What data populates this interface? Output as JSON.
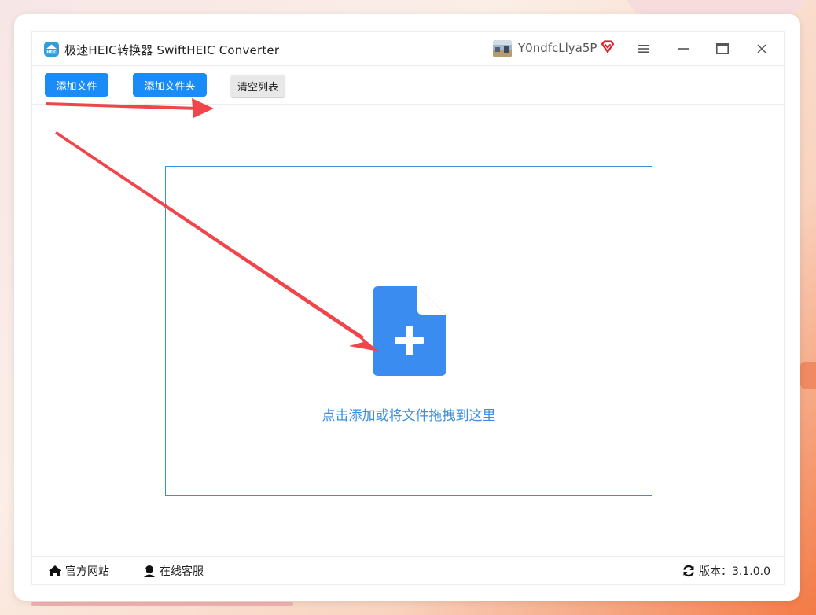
{
  "window": {
    "title": "极速HEIC转换器 SwiftHEIC Converter",
    "username": "Y0ndfcLlya5P",
    "logo_text": "HEIC"
  },
  "toolbar": {
    "add_file": "添加文件",
    "add_folder": "添加文件夹",
    "clear_list": "清空列表"
  },
  "dropzone": {
    "prompt": "点击添加或将文件拖拽到这里"
  },
  "footer": {
    "website": "官方网站",
    "support": "在线客服",
    "version_label": "版本：3.1.0.0"
  },
  "colors": {
    "primary": "#1a8cf7",
    "drop_border": "#3a8fd6",
    "drop_icon": "#3b8cf1",
    "drop_text": "#3a90dd",
    "annotation_arrow": "#f0464b",
    "vip": "#e0202a"
  },
  "icons": [
    "app-logo",
    "avatar",
    "vip-diamond-icon",
    "menu-icon",
    "minimize-icon",
    "maximize-icon",
    "close-icon",
    "file-add-icon",
    "home-icon",
    "support-agent-icon",
    "refresh-icon"
  ]
}
